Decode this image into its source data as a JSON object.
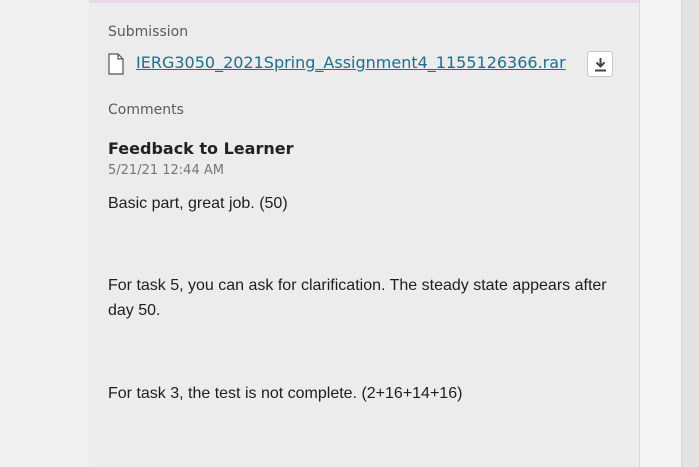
{
  "submission": {
    "label": "Submission",
    "file_icon": "file-icon",
    "file_name": "IERG3050_2021Spring_Assignment4_1155126366.rar",
    "download_icon": "download-icon"
  },
  "comments": {
    "label": "Comments",
    "feedback_title": "Feedback to Learner",
    "feedback_date": "5/21/21 12:44 AM",
    "paragraphs": [
      "Basic part, great job. (50)",
      "For task 5, you can ask for clarification. The steady state appears after day 50.",
      "For task 3, the test is not complete. (2+16+14+16)"
    ]
  }
}
